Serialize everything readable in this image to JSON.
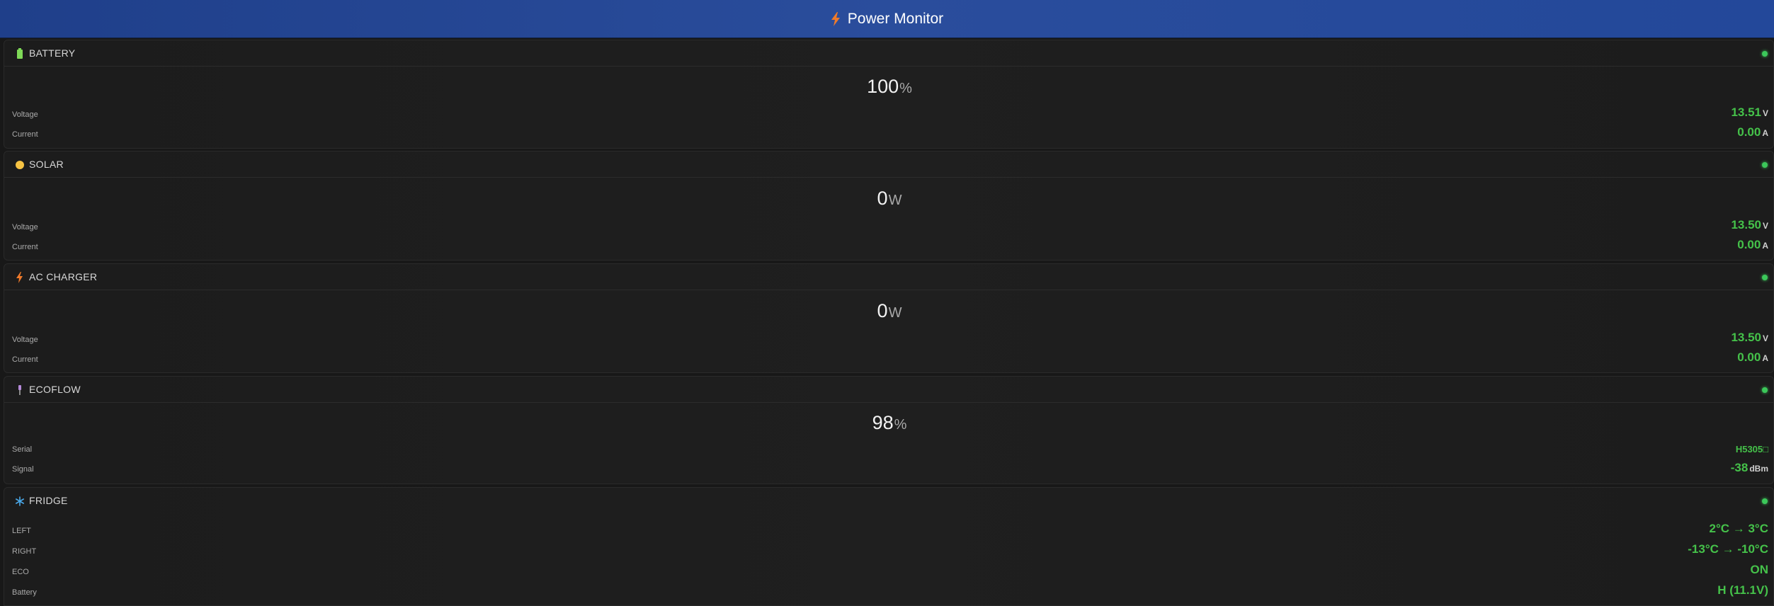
{
  "header": {
    "title": "Power Monitor",
    "icon": "bolt-icon",
    "accent": "#f07a2a"
  },
  "status_color": "#3cc85a",
  "panels": {
    "battery": {
      "title": "BATTERY",
      "icon": "battery-icon",
      "main_value": "100",
      "main_unit": "%",
      "rows": [
        {
          "label": "Voltage",
          "value": "13.51",
          "unit": "V"
        },
        {
          "label": "Current",
          "value": "0.00",
          "unit": "A"
        }
      ]
    },
    "solar": {
      "title": "SOLAR",
      "icon": "sun-icon",
      "main_value": "0",
      "main_unit": "W",
      "rows": [
        {
          "label": "Voltage",
          "value": "13.50",
          "unit": "V"
        },
        {
          "label": "Current",
          "value": "0.00",
          "unit": "A"
        }
      ]
    },
    "ac_charger": {
      "title": "AC CHARGER",
      "icon": "bolt-icon",
      "main_value": "0",
      "main_unit": "W",
      "rows": [
        {
          "label": "Voltage",
          "value": "13.50",
          "unit": "V"
        },
        {
          "label": "Current",
          "value": "0.00",
          "unit": "A"
        }
      ]
    },
    "ecoflow": {
      "title": "ECOFLOW",
      "icon": "plug-icon",
      "main_value": "98",
      "main_unit": "%",
      "rows": [
        {
          "label": "Serial",
          "value": "H5305□",
          "unit": ""
        },
        {
          "label": "Signal",
          "value": "-38",
          "unit": "dBm"
        }
      ]
    },
    "fridge": {
      "title": "FRIDGE",
      "icon": "snowflake-icon",
      "rows": [
        {
          "label": "LEFT",
          "value": "2°C → 3°C"
        },
        {
          "label": "RIGHT",
          "value": "-13°C → -10°C"
        },
        {
          "label": "ECO",
          "value": "ON"
        },
        {
          "label": "Battery",
          "value": "H (11.1V)"
        }
      ]
    }
  }
}
